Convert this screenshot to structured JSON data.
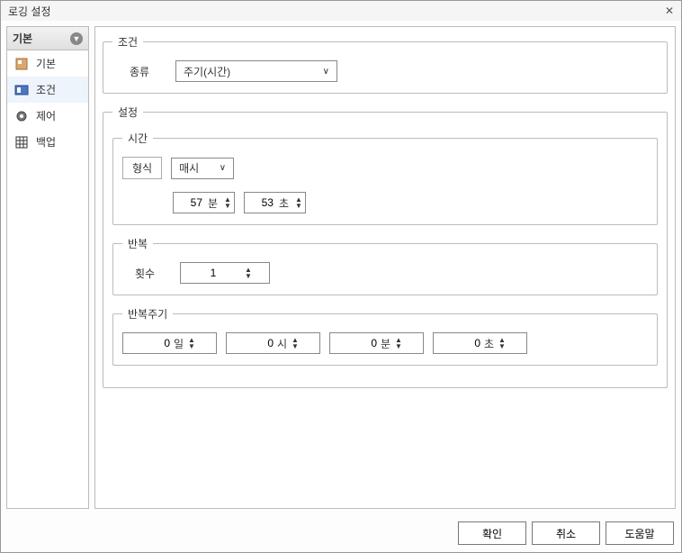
{
  "window": {
    "title": "로깅 설정"
  },
  "sidebar": {
    "header": "기본",
    "items": [
      {
        "label": "기본"
      },
      {
        "label": "조건"
      },
      {
        "label": "제어"
      },
      {
        "label": "백업"
      }
    ]
  },
  "condition": {
    "legend": "조건",
    "type_label": "종류",
    "type_value": "주기(시간)"
  },
  "settings": {
    "legend": "설정",
    "time": {
      "legend": "시간",
      "format_label": "형식",
      "format_value": "매시",
      "minute_value": "57",
      "minute_unit": "분",
      "second_value": "53",
      "second_unit": "초"
    },
    "repeat": {
      "legend": "반복",
      "count_label": "횟수",
      "count_value": "1"
    },
    "cycle": {
      "legend": "반복주기",
      "day_value": "0",
      "day_unit": "일",
      "hour_value": "0",
      "hour_unit": "시",
      "minute_value": "0",
      "minute_unit": "분",
      "second_value": "0",
      "second_unit": "초"
    }
  },
  "buttons": {
    "ok": "확인",
    "cancel": "취소",
    "help": "도움말"
  }
}
